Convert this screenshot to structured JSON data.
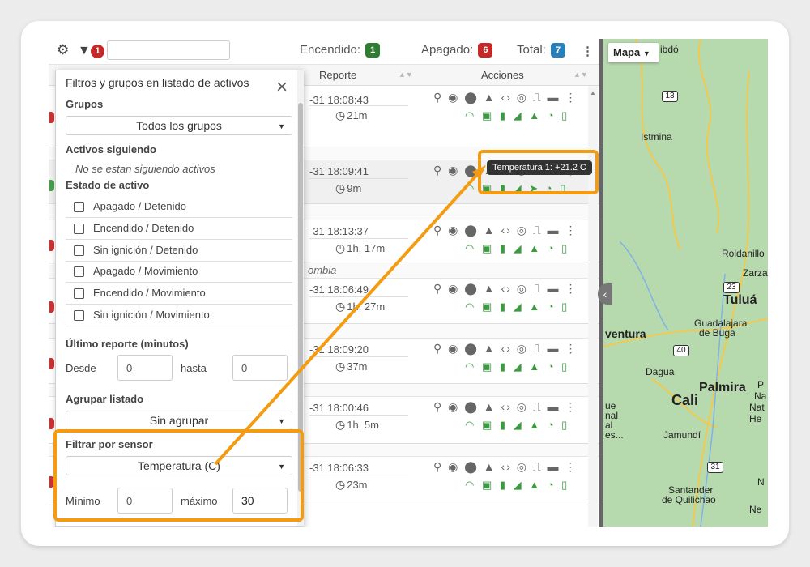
{
  "topbar": {
    "alert_count": "1",
    "search_value": "",
    "on": {
      "label": "Encendido:",
      "count": "1",
      "color": "#2e7d32"
    },
    "off": {
      "label": "Apagado:",
      "count": "6",
      "color": "#c62828"
    },
    "total": {
      "label": "Total:",
      "count": "7",
      "color": "#2980b9"
    }
  },
  "table": {
    "columns": [
      "Reporte",
      "Acciones"
    ],
    "rows": [
      {
        "time": "-31 18:08:43",
        "duration": "21m",
        "status_color": "#d32f2f"
      },
      {
        "time": "-31 18:09:41",
        "duration": "9m",
        "status_color": "#43a047"
      },
      {
        "time": "-31 18:13:37",
        "duration": "1h, 17m",
        "status_color": "#d32f2f"
      },
      {
        "time": "-31 18:06:49",
        "duration": "1h, 27m",
        "status_color": "#d32f2f"
      },
      {
        "time": "-31 18:09:20",
        "duration": "37m",
        "status_color": "#d32f2f"
      },
      {
        "time": "-31 18:00:46",
        "duration": "1h, 5m",
        "status_color": "#d32f2f"
      },
      {
        "time": "-31 18:06:33",
        "duration": "23m",
        "status_color": "#d32f2f"
      }
    ],
    "group_label": "ombia",
    "tooltip": "Temperatura 1: +21.2 C"
  },
  "panel": {
    "title": "Filtros y grupos en listado de activos",
    "groups_label": "Grupos",
    "groups_value": "Todos los grupos",
    "following_label": "Activos siguiendo",
    "following_note": "No se estan siguiendo activos",
    "state_label": "Estado de activo",
    "states": [
      "Apagado / Detenido",
      "Encendido / Detenido",
      "Sin ignición / Detenido",
      "Apagado / Movimiento",
      "Encendido / Movimiento",
      "Sin ignición / Movimiento"
    ],
    "last_report_label": "Último reporte (minutos)",
    "from_label": "Desde",
    "from_value": "0",
    "to_label": "hasta",
    "to_value": "0",
    "group_list_label": "Agrupar listado",
    "group_list_value": "Sin agrupar",
    "sensor_label": "Filtrar por sensor",
    "sensor_value": "Temperatura (C)",
    "min_label": "Mínimo",
    "min_value": "0",
    "max_label": "máximo",
    "max_value": "30"
  },
  "map": {
    "type_button": "Mapa",
    "labels": [
      "ibdó",
      "Istmina",
      "Roldanillo",
      "Zarza",
      "Tuluá",
      "Guadalajara",
      "de Buga",
      "ventura",
      "Dagua",
      "Palmira",
      "Cali",
      "Jamundí",
      "Santander",
      "de Quilichao",
      "ue",
      "nal",
      "al",
      "es...",
      "P",
      "Na",
      "Nat",
      "He",
      "N",
      "Ne"
    ],
    "routes": [
      "13",
      "23",
      "40",
      "31"
    ]
  },
  "colors": {
    "highlight": "#f39c12",
    "icon_green": "#3c9b41"
  }
}
